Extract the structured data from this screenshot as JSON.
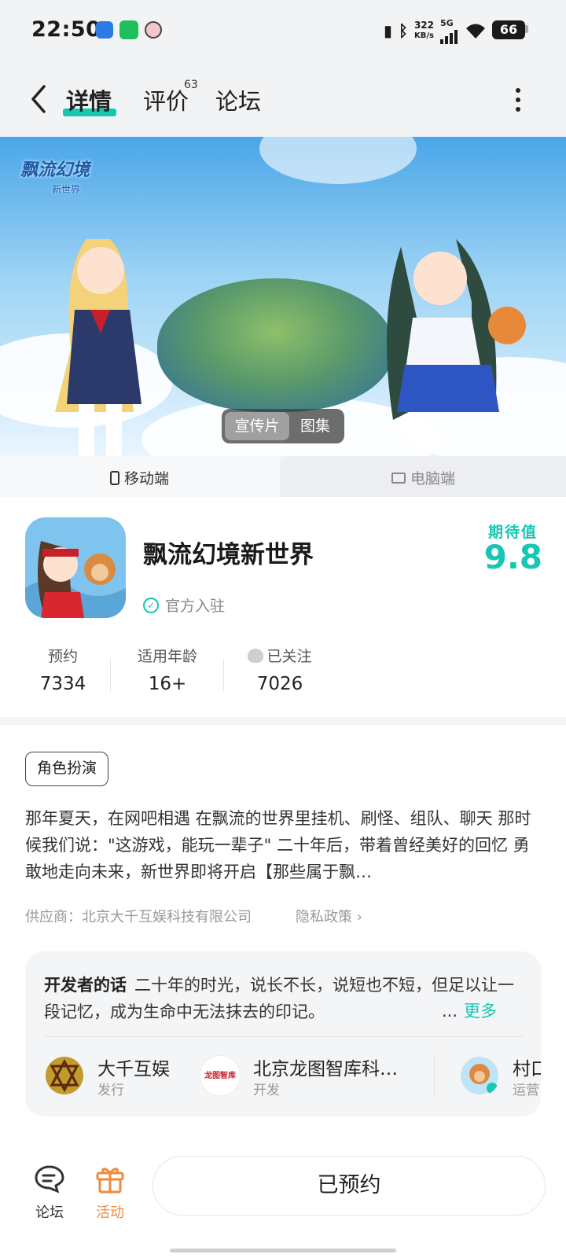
{
  "status_bar": {
    "time": "22:50",
    "net_speed_value": "322",
    "net_speed_unit": "KB/s",
    "network": "5G",
    "battery": "66",
    "icons": [
      "message-icon",
      "wechat-icon",
      "avatar-icon",
      "vibrate-icon",
      "bluetooth-icon",
      "signal-icon",
      "wifi-icon",
      "battery-icon"
    ]
  },
  "nav": {
    "tabs": [
      {
        "label": "详情",
        "active": true
      },
      {
        "label": "评价",
        "badge": "63"
      },
      {
        "label": "论坛"
      }
    ],
    "accent_color": "#16c7b3"
  },
  "banner": {
    "logo_text": "飘流幻境",
    "logo_sub": "新世界",
    "media_tabs": [
      "宣传片",
      "图集"
    ],
    "active_media": "宣传片"
  },
  "platform_tabs": {
    "mobile": "移动端",
    "pc": "电脑端",
    "active": "移动端"
  },
  "app": {
    "name": "飘流幻境新世界",
    "official_label": "官方入驻",
    "expect_label": "期待值",
    "expect_score": "9.8",
    "stats": [
      {
        "label": "预约",
        "value": "7334"
      },
      {
        "label": "适用年龄",
        "value": "16+"
      },
      {
        "label": "已关注",
        "value": "7026"
      }
    ],
    "tag": "角色扮演",
    "description": "那年夏天，在网吧相遇 在飘流的世界里挂机、刷怪、组队、聊天 那时候我们说：\"这游戏，能玩一辈子\" 二十年后，带着曾经美好的回忆 勇敢地走向未来，新世界即将开启【那些属于飘…",
    "supplier": "供应商：北京大千互娱科技有限公司",
    "privacy": "隐私政策"
  },
  "developer": {
    "title": "开发者的话",
    "words": "二十年的时光，说长不长，说短也不短，但足以让一段记忆，成为生命中无法抹去的印记。",
    "ellipsis": "...",
    "more": "更多",
    "partners": [
      {
        "name": "大千互娱",
        "role": "发行"
      },
      {
        "name": "北京龙图智库科…",
        "role": "开发",
        "logo_text": "龙图智库"
      },
      {
        "name": "村口",
        "role": "运营"
      }
    ]
  },
  "bottom_bar": {
    "forum_label": "论坛",
    "activity_label": "活动",
    "reserve_label": "已预约",
    "activity_color": "#f08a3c"
  }
}
